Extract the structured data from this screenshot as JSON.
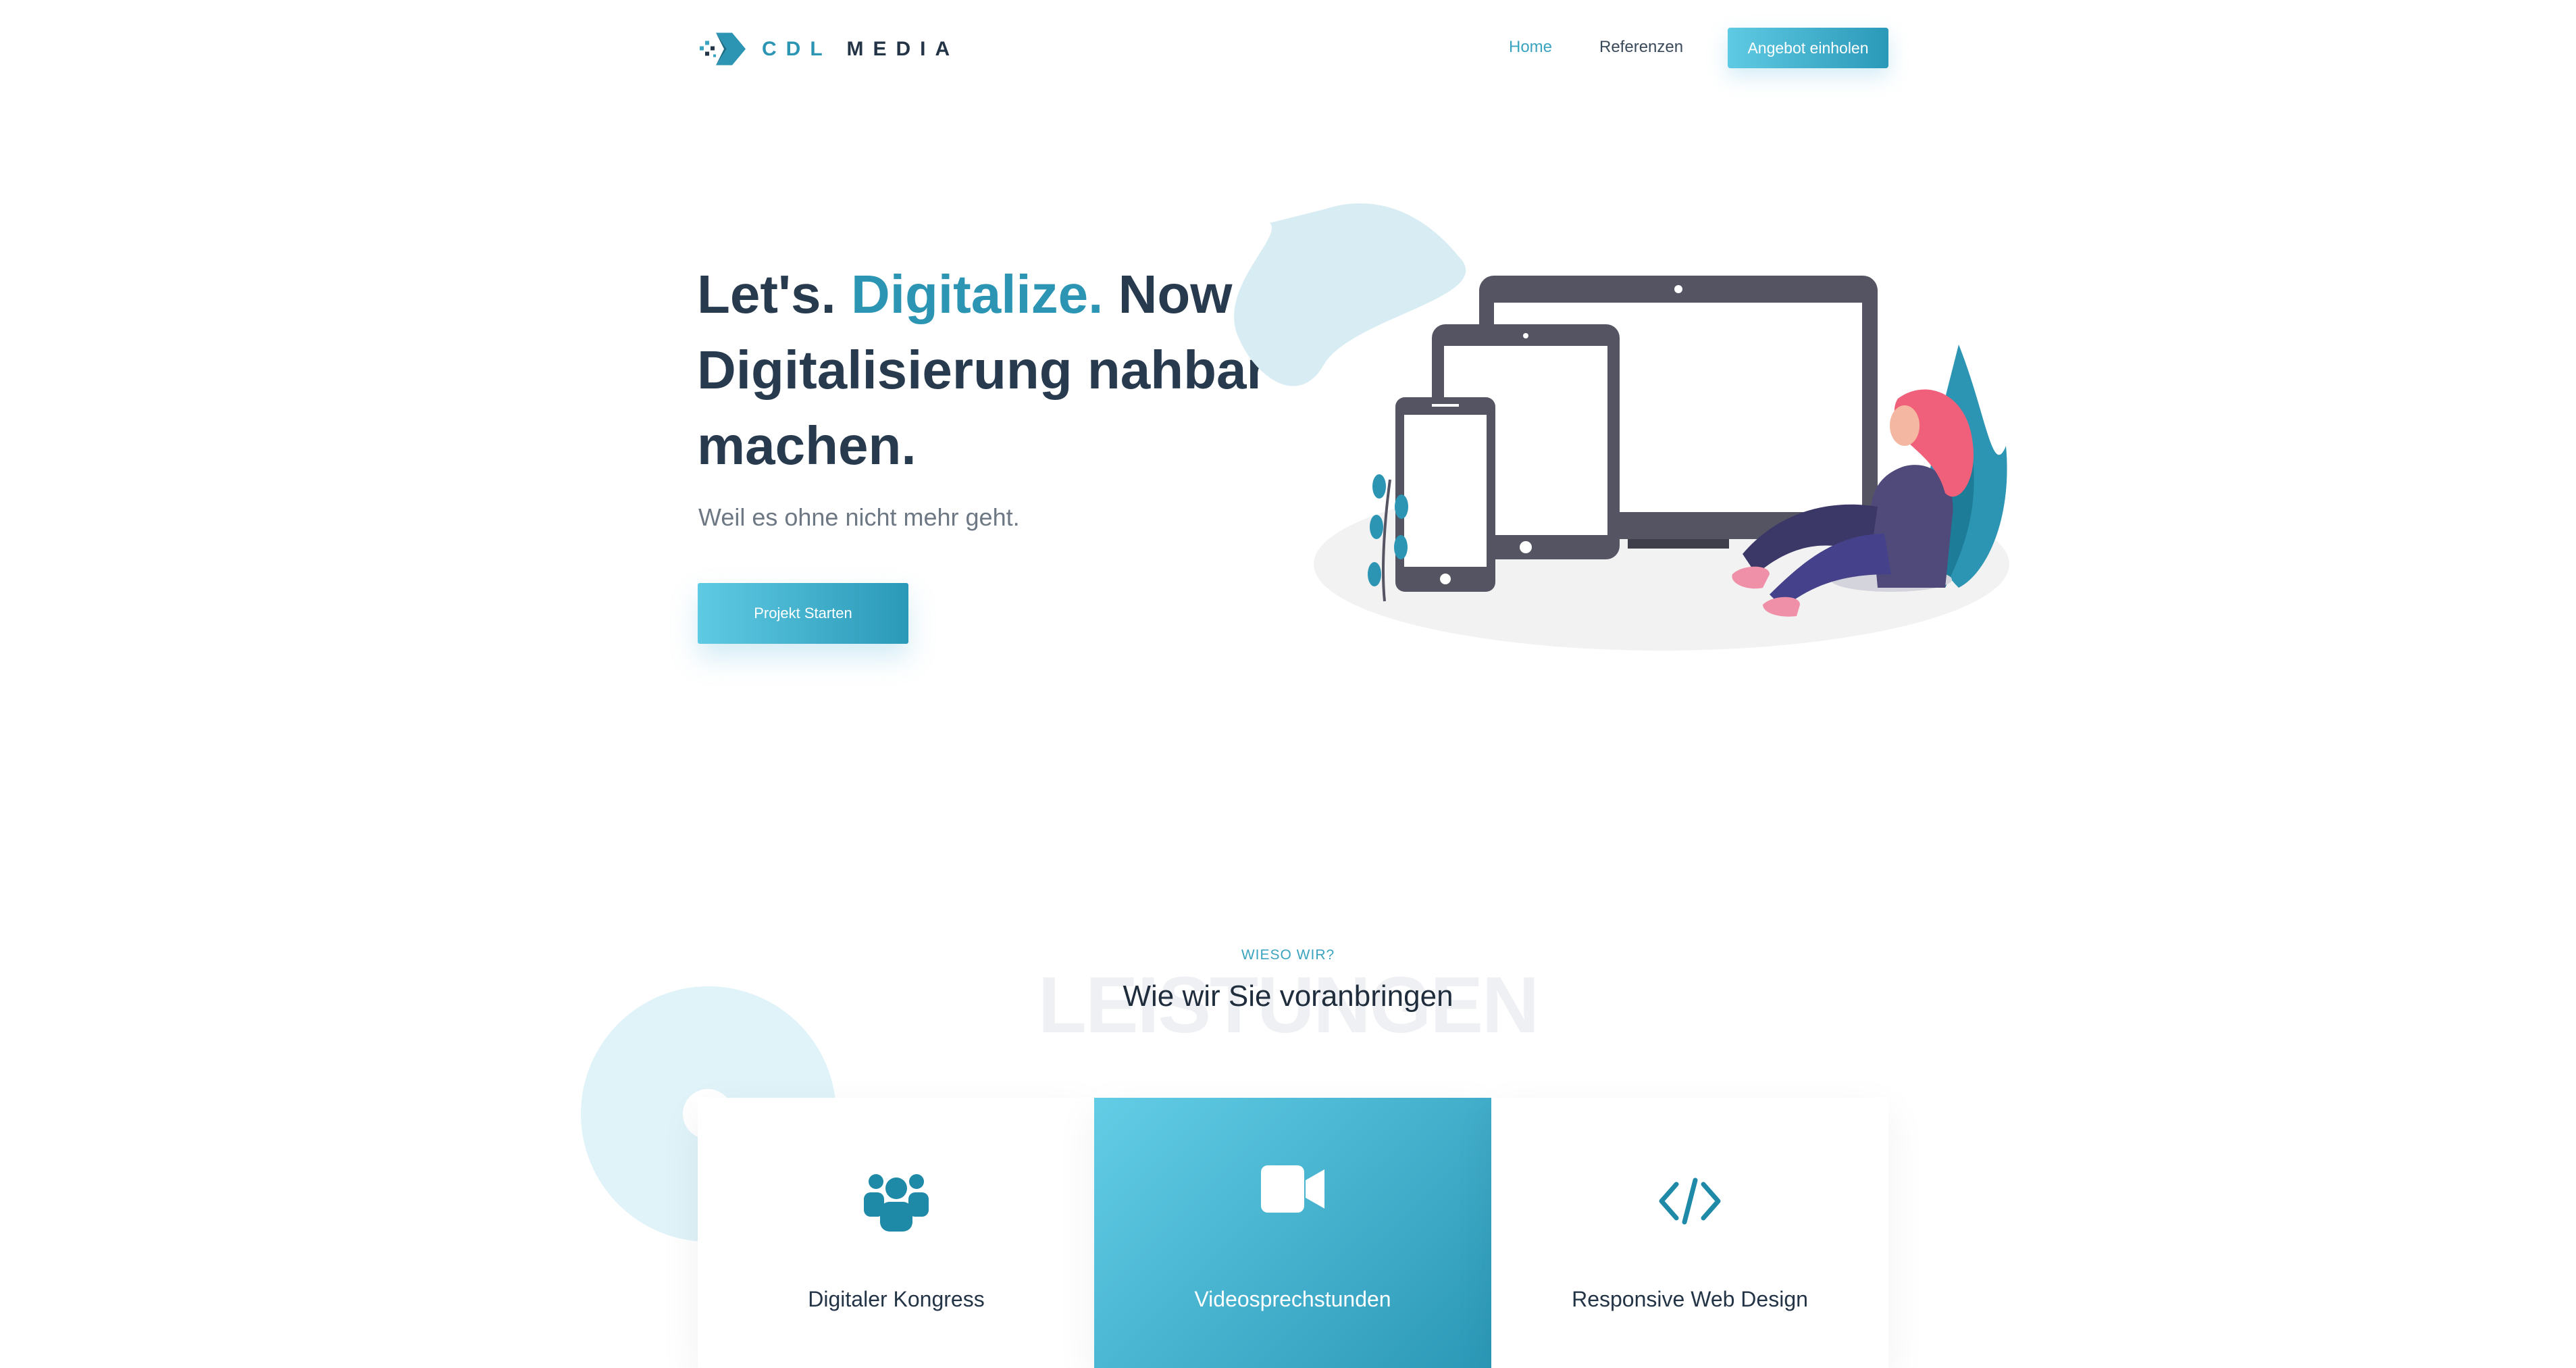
{
  "brand": {
    "part1": "CDL",
    "part2": "MEDIA"
  },
  "nav": {
    "items": [
      {
        "label": "Home",
        "active": true
      },
      {
        "label": "Referenzen",
        "active": false
      }
    ],
    "cta": "Angebot einholen"
  },
  "hero": {
    "title_start": "Let's. ",
    "title_accent": "Digitalize.",
    "title_end": " Now - Digitalisierung nahbar machen.",
    "subtitle": "Weil es ohne nicht mehr geht.",
    "button": "Projekt Starten"
  },
  "services": {
    "tag": "WIESO WIR?",
    "background_word": "LEISTUNGEN",
    "title": "Wie wir Sie voranbringen",
    "cards": [
      {
        "label": "Digitaler Kongress",
        "icon": "users-icon"
      },
      {
        "label": "Videosprechstunden",
        "icon": "video-camera-icon"
      },
      {
        "label": "Responsive Web Design",
        "icon": "code-icon"
      }
    ]
  },
  "colors": {
    "accent": "#2b95b3",
    "accent_light": "#5fcae3",
    "dark": "#283a4e",
    "device": "#545463",
    "hair": "#f0607a"
  }
}
